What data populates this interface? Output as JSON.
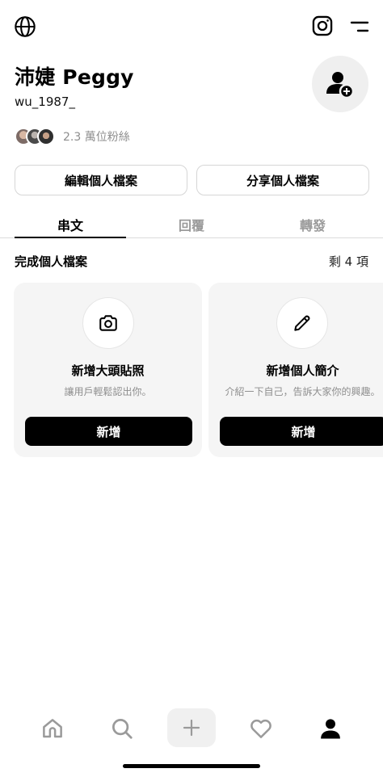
{
  "topbar": {
    "globe_icon": "globe-icon",
    "instagram_icon": "instagram-icon",
    "menu_icon": "menu-icon"
  },
  "profile": {
    "display_name": "沛婕 Peggy",
    "username": "wu_1987_",
    "followers_text": "2.3 萬位粉絲",
    "avatar_icon": "add-person-icon"
  },
  "actions": {
    "edit_label": "編輯個人檔案",
    "share_label": "分享個人檔案"
  },
  "tabs": [
    {
      "label": "串文",
      "active": true
    },
    {
      "label": "回覆",
      "active": false
    },
    {
      "label": "轉發",
      "active": false
    }
  ],
  "complete_profile": {
    "title": "完成個人檔案",
    "remaining": "剩 4 項",
    "cards": [
      {
        "icon": "camera-icon",
        "title": "新增大頭貼照",
        "description": "讓用戶輕鬆認出你。",
        "button_label": "新增"
      },
      {
        "icon": "pencil-icon",
        "title": "新增個人簡介",
        "description": "介紹一下自己，告訴大家你的興趣。",
        "button_label": "新增"
      }
    ]
  },
  "bottom_nav": {
    "items": [
      "home-icon",
      "search-icon",
      "plus-icon",
      "heart-icon",
      "profile-icon"
    ],
    "active": "profile-icon"
  },
  "colors": {
    "accent": "#000000",
    "muted_text": "#8e8e8e",
    "card_bg": "#f5f5f5"
  }
}
